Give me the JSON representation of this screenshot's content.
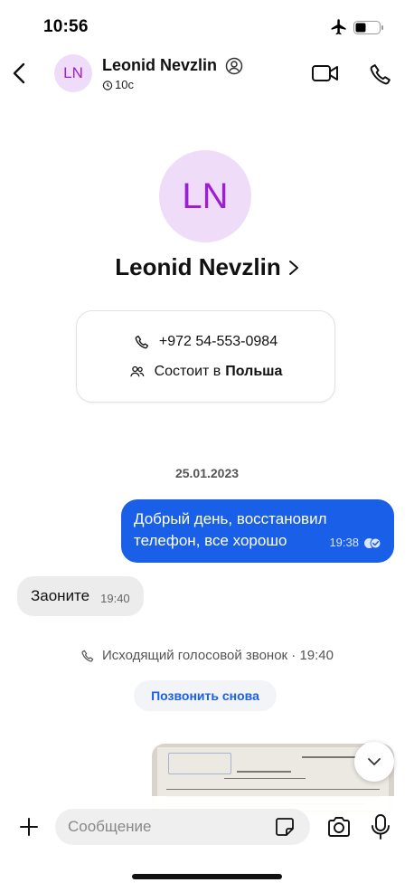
{
  "status_bar": {
    "time": "10:56"
  },
  "header": {
    "avatar_initials": "LN",
    "name": "Leonid Nevzlin",
    "disappearing_timer": "10с"
  },
  "profile": {
    "avatar_initials": "LN",
    "name": "Leonid Nevzlin",
    "phone": "+972 54-553-0984",
    "groups_prefix": "Состоит в",
    "groups_name": "Польша"
  },
  "conversation": {
    "date_separator": "25.01.2023",
    "outgoing_message": {
      "text": "Добрый день, восстановил телефон, все хорошо",
      "time": "19:38",
      "status": "read"
    },
    "incoming_message": {
      "text": "Заоните",
      "time": "19:40"
    },
    "call_event": {
      "text": "Исходящий голосовой звонок · 19:40"
    },
    "call_again_label": "Позвонить снова"
  },
  "composer": {
    "placeholder": "Сообщение"
  },
  "colors": {
    "accent": "#1a5fe8",
    "avatar_bg": "#efdcf9",
    "avatar_text": "#9b1fd4",
    "incoming_bubble": "#ececec"
  },
  "icons": [
    "airplane-icon",
    "battery-icon",
    "back-icon",
    "verified-icon",
    "timer-icon",
    "video-call-icon",
    "phone-icon",
    "chevron-right-icon",
    "group-icon",
    "read-receipt-icon",
    "chevron-down-icon",
    "plus-icon",
    "sticker-icon",
    "camera-icon",
    "mic-icon"
  ]
}
